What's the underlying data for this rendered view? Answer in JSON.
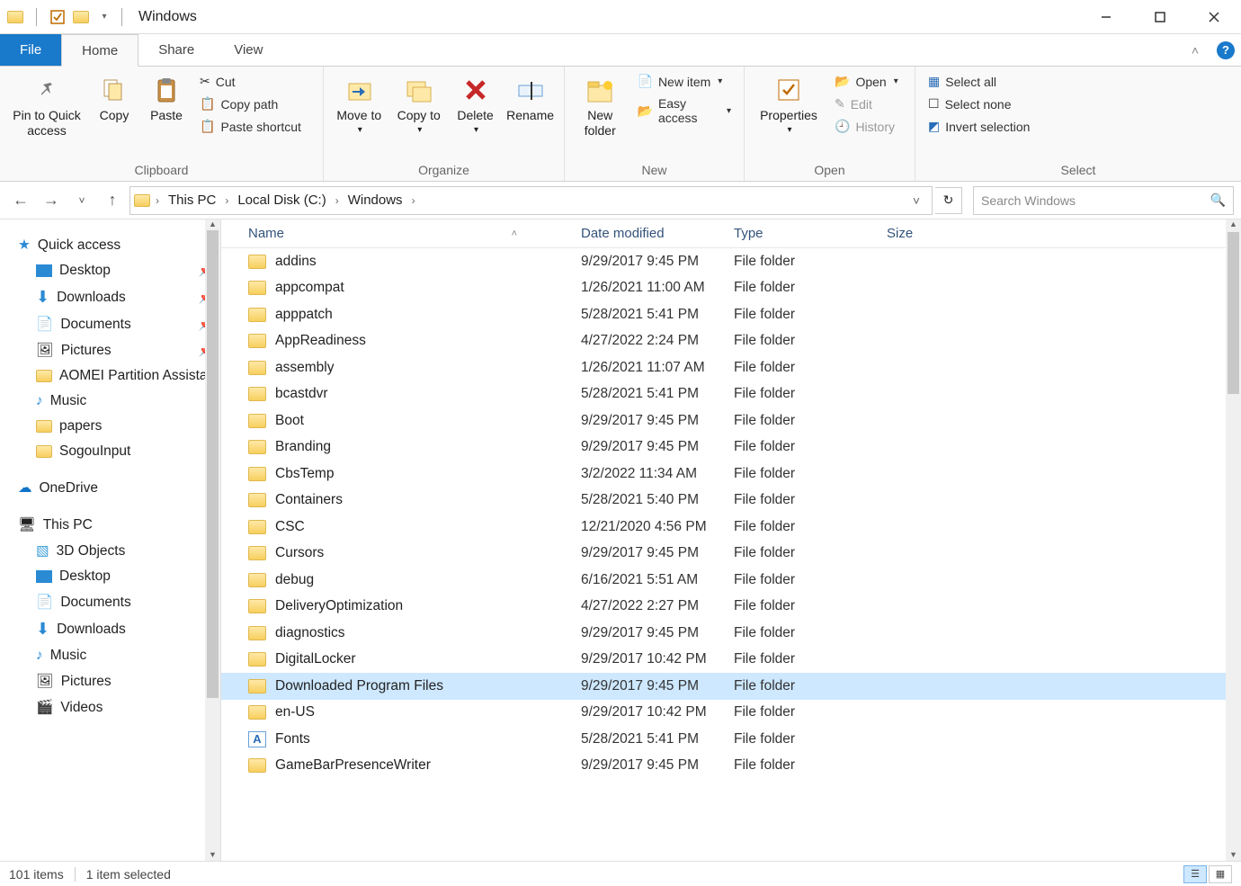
{
  "window": {
    "title": "Windows"
  },
  "tabs": {
    "file": "File",
    "home": "Home",
    "share": "Share",
    "view": "View"
  },
  "ribbon": {
    "clipboard": {
      "label": "Clipboard",
      "pin": "Pin to Quick access",
      "copy": "Copy",
      "paste": "Paste",
      "cut": "Cut",
      "copy_path": "Copy path",
      "paste_shortcut": "Paste shortcut"
    },
    "organize": {
      "label": "Organize",
      "move_to": "Move to",
      "copy_to": "Copy to",
      "delete": "Delete",
      "rename": "Rename"
    },
    "new": {
      "label": "New",
      "new_folder": "New folder",
      "new_item": "New item",
      "easy_access": "Easy access"
    },
    "open": {
      "label": "Open",
      "properties": "Properties",
      "open": "Open",
      "edit": "Edit",
      "history": "History"
    },
    "select": {
      "label": "Select",
      "select_all": "Select all",
      "select_none": "Select none",
      "invert": "Invert selection"
    }
  },
  "breadcrumb": {
    "pc": "This PC",
    "drive": "Local Disk (C:)",
    "folder": "Windows"
  },
  "search": {
    "placeholder": "Search Windows"
  },
  "sidebar": {
    "quick_access": "Quick access",
    "desktop": "Desktop",
    "downloads": "Downloads",
    "documents": "Documents",
    "pictures": "Pictures",
    "aomei": "AOMEI Partition Assista",
    "music": "Music",
    "papers": "papers",
    "sogou": "SogouInput",
    "onedrive": "OneDrive",
    "this_pc": "This PC",
    "objects3d": "3D Objects",
    "desktop2": "Desktop",
    "documents2": "Documents",
    "downloads2": "Downloads",
    "music2": "Music",
    "pictures2": "Pictures",
    "videos": "Videos"
  },
  "columns": {
    "name": "Name",
    "date": "Date modified",
    "type": "Type",
    "size": "Size"
  },
  "files": [
    {
      "name": "addins",
      "date": "9/29/2017 9:45 PM",
      "type": "File folder",
      "icon": "folder"
    },
    {
      "name": "appcompat",
      "date": "1/26/2021 11:00 AM",
      "type": "File folder",
      "icon": "folder"
    },
    {
      "name": "apppatch",
      "date": "5/28/2021 5:41 PM",
      "type": "File folder",
      "icon": "folder"
    },
    {
      "name": "AppReadiness",
      "date": "4/27/2022 2:24 PM",
      "type": "File folder",
      "icon": "folder"
    },
    {
      "name": "assembly",
      "date": "1/26/2021 11:07 AM",
      "type": "File folder",
      "icon": "folder"
    },
    {
      "name": "bcastdvr",
      "date": "5/28/2021 5:41 PM",
      "type": "File folder",
      "icon": "folder"
    },
    {
      "name": "Boot",
      "date": "9/29/2017 9:45 PM",
      "type": "File folder",
      "icon": "folder"
    },
    {
      "name": "Branding",
      "date": "9/29/2017 9:45 PM",
      "type": "File folder",
      "icon": "folder"
    },
    {
      "name": "CbsTemp",
      "date": "3/2/2022 11:34 AM",
      "type": "File folder",
      "icon": "folder"
    },
    {
      "name": "Containers",
      "date": "5/28/2021 5:40 PM",
      "type": "File folder",
      "icon": "folder"
    },
    {
      "name": "CSC",
      "date": "12/21/2020 4:56 PM",
      "type": "File folder",
      "icon": "folder"
    },
    {
      "name": "Cursors",
      "date": "9/29/2017 9:45 PM",
      "type": "File folder",
      "icon": "folder"
    },
    {
      "name": "debug",
      "date": "6/16/2021 5:51 AM",
      "type": "File folder",
      "icon": "folder"
    },
    {
      "name": "DeliveryOptimization",
      "date": "4/27/2022 2:27 PM",
      "type": "File folder",
      "icon": "folder"
    },
    {
      "name": "diagnostics",
      "date": "9/29/2017 9:45 PM",
      "type": "File folder",
      "icon": "folder"
    },
    {
      "name": "DigitalLocker",
      "date": "9/29/2017 10:42 PM",
      "type": "File folder",
      "icon": "folder"
    },
    {
      "name": "Downloaded Program Files",
      "date": "9/29/2017 9:45 PM",
      "type": "File folder",
      "icon": "folder",
      "selected": true
    },
    {
      "name": "en-US",
      "date": "9/29/2017 10:42 PM",
      "type": "File folder",
      "icon": "folder"
    },
    {
      "name": "Fonts",
      "date": "5/28/2021 5:41 PM",
      "type": "File folder",
      "icon": "fonts"
    },
    {
      "name": "GameBarPresenceWriter",
      "date": "9/29/2017 9:45 PM",
      "type": "File folder",
      "icon": "folder"
    }
  ],
  "status": {
    "count": "101 items",
    "selected": "1 item selected"
  }
}
